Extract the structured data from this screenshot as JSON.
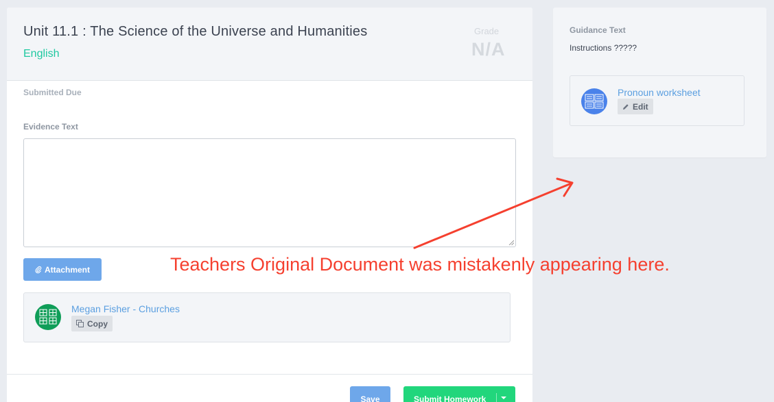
{
  "assignment": {
    "title": "Unit 11.1 : The Science of the Universe and Humanities",
    "subject": "English",
    "grade_label": "Grade",
    "grade_value": "N/A",
    "submitted_due_label": "Submitted Due"
  },
  "evidence": {
    "label": "Evidence Text",
    "value": "",
    "placeholder": ""
  },
  "attachment": {
    "button_label": "Attachment",
    "icon": "paperclip-icon"
  },
  "student_file": {
    "name": "Megan Fisher - Churches",
    "action_label": "Copy",
    "icon": "google-sheets-icon",
    "icon_color": "#0f9d58"
  },
  "footer": {
    "save_label": "Save",
    "submit_label": "Submit Homework"
  },
  "guidance": {
    "label": "Guidance Text",
    "instructions": "Instructions ?????",
    "file": {
      "name": "Pronoun worksheet",
      "action_label": "Edit",
      "icon": "google-docs-icon",
      "icon_color": "#4a82ea"
    }
  },
  "annotation": {
    "text": "Teachers Original Document was mistakenly appearing here.",
    "color": "#f5402f"
  },
  "colors": {
    "accent_green": "#1ec8a0",
    "primary_blue": "#6ea7ea",
    "submit_green": "#21d67c",
    "link_blue": "#5b9fe0"
  }
}
